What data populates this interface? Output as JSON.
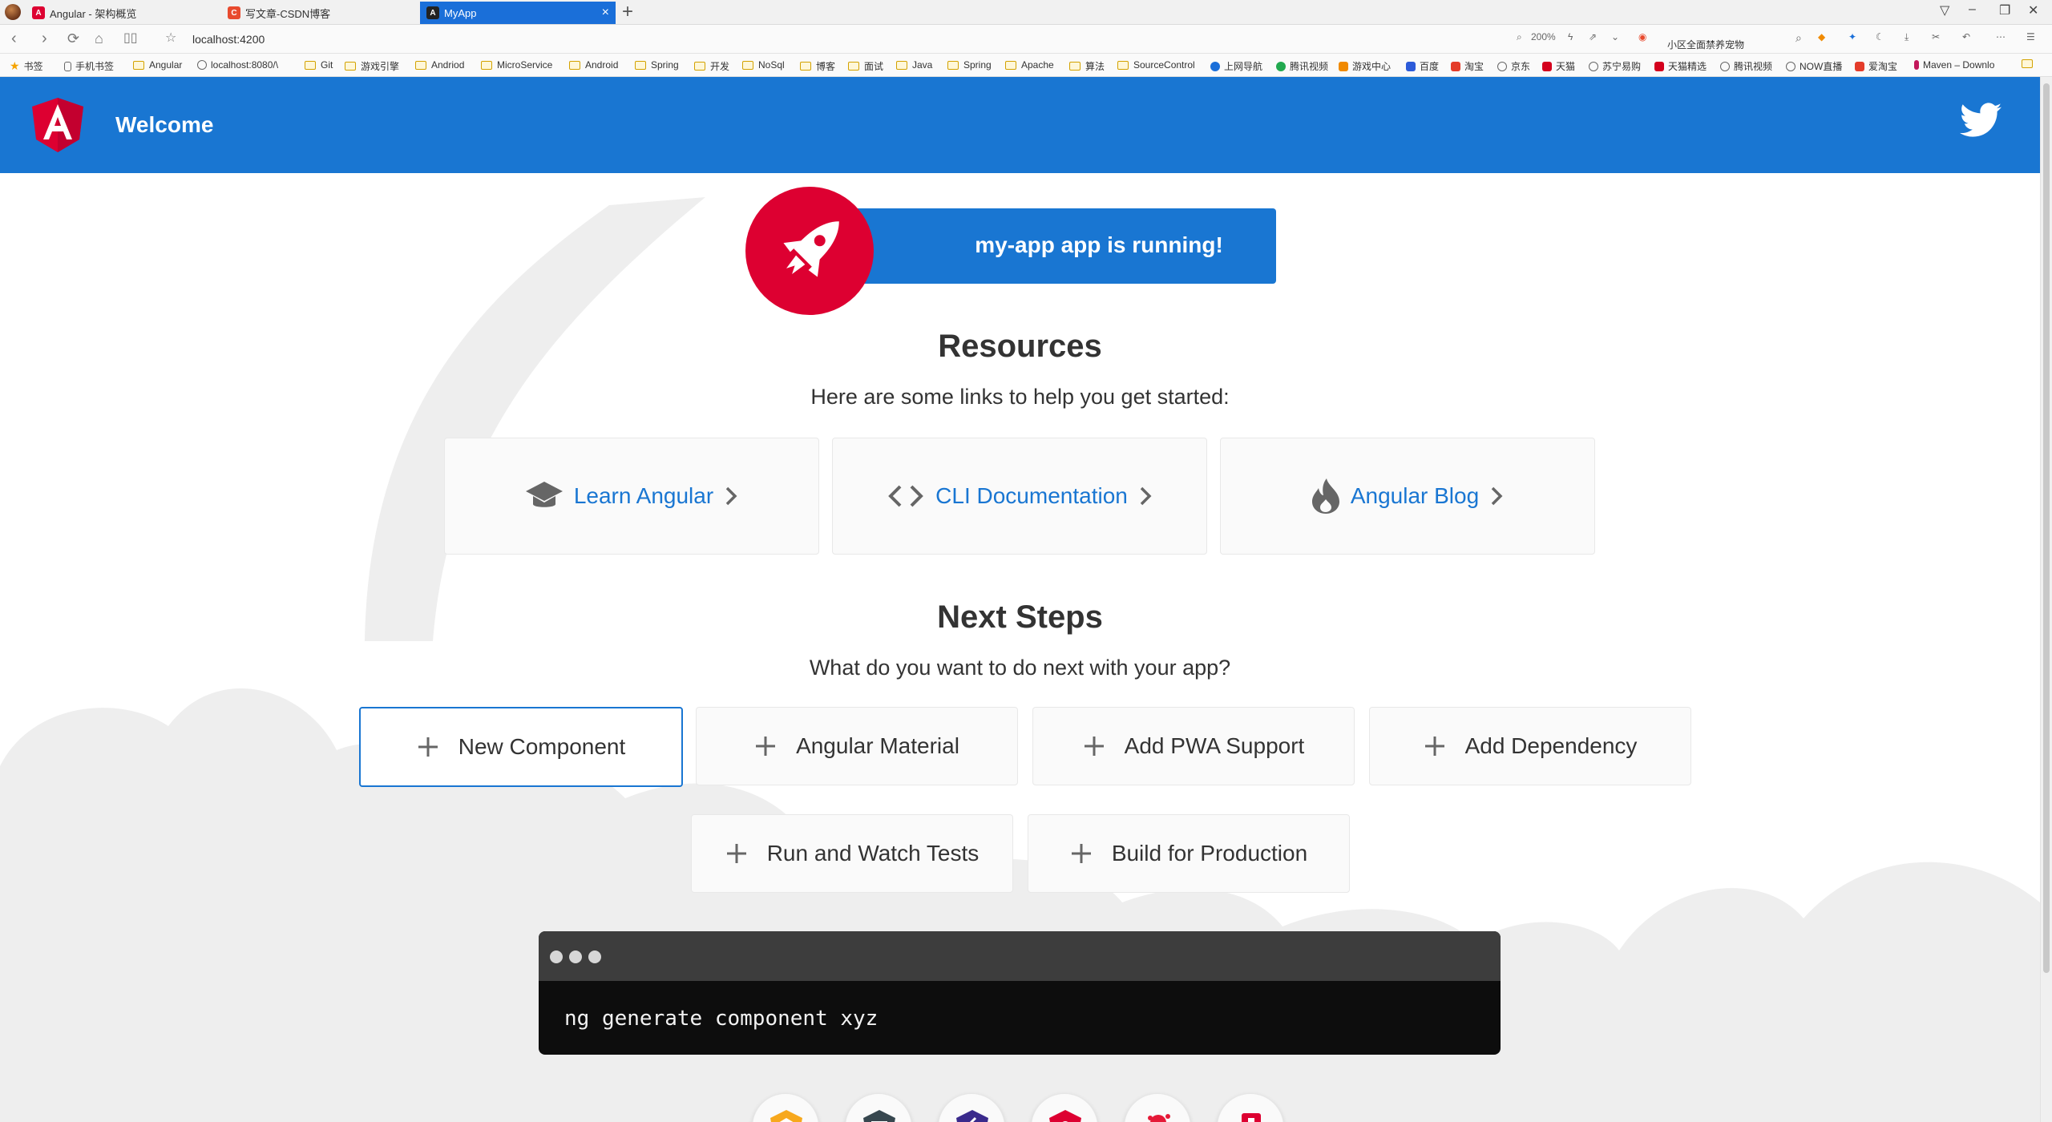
{
  "browser": {
    "tabs": [
      {
        "label": "Angular - 架构概览",
        "fav": "A",
        "color": "#dd0031"
      },
      {
        "label": "写文章-CSDN博客",
        "fav": "C",
        "color": "#e84a2e"
      },
      {
        "label": "MyApp",
        "fav": "A",
        "color": "#222222"
      }
    ],
    "new_tab": "+",
    "address": "localhost:4200",
    "zoom": "200%",
    "promo": "小区全面禁养宠物",
    "bookmarks": [
      "书签",
      "手机书签",
      "Angular",
      "localhost:8080/\\",
      "Git",
      "游戏引擎",
      "Andriod",
      "MicroService",
      "Android",
      "Spring",
      "开发",
      "NoSql",
      "博客",
      "面试",
      "Java",
      "Spring",
      "Apache",
      "算法",
      "SourceControl",
      "上网导航",
      "腾讯视频",
      "游戏中心",
      "百度",
      "淘宝",
      "京东",
      "天猫",
      "苏宁易购",
      "天猫精选",
      "腾讯视频",
      "NOW直播",
      "爱淘宝",
      "Maven – Downlo"
    ]
  },
  "toolbar": {
    "title": "Welcome",
    "brand_color": "#1976d2"
  },
  "banner": {
    "text": "my-app app is running!"
  },
  "resources": {
    "title": "Resources",
    "subtitle": "Here are some links to help you get started:",
    "cards": [
      {
        "label": "Learn Angular",
        "icon": "graduation-cap-icon"
      },
      {
        "label": "CLI Documentation",
        "icon": "code-brackets-icon"
      },
      {
        "label": "Angular Blog",
        "icon": "flame-icon"
      }
    ]
  },
  "next_steps": {
    "title": "Next Steps",
    "subtitle": "What do you want to do next with your app?",
    "buttons": [
      {
        "label": "New Component"
      },
      {
        "label": "Angular Material"
      },
      {
        "label": "Add PWA Support"
      },
      {
        "label": "Add Dependency"
      },
      {
        "label": "Run and Watch Tests"
      },
      {
        "label": "Build for Production"
      }
    ]
  },
  "terminal": {
    "command": "ng generate component xyz"
  },
  "colors": {
    "angular_red": "#dd0031",
    "text": "#333333",
    "card_bg": "#fafafa"
  }
}
